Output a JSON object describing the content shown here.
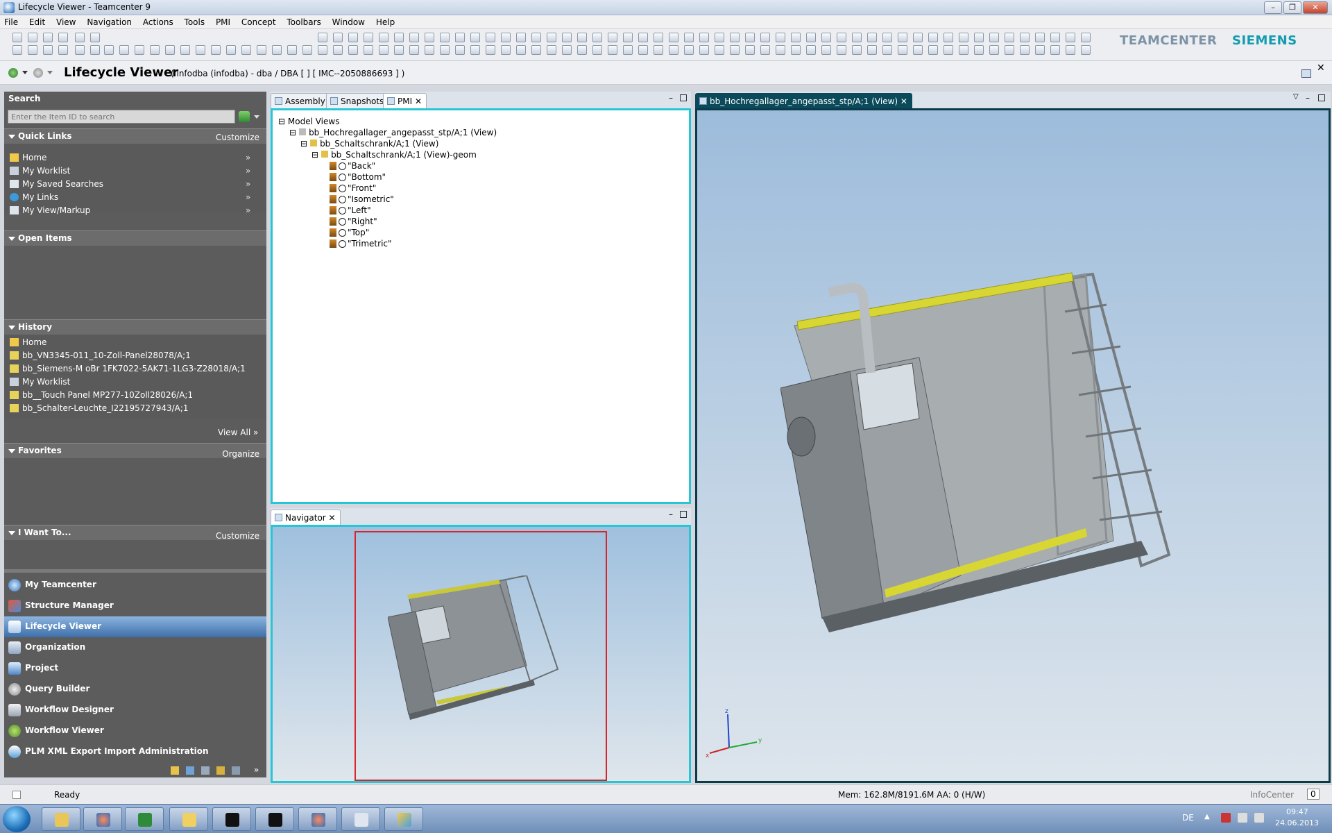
{
  "window": {
    "title": "Lifecycle Viewer - Teamcenter 9"
  },
  "menu": [
    "File",
    "Edit",
    "View",
    "Navigation",
    "Actions",
    "Tools",
    "PMI",
    "Concept",
    "Toolbars",
    "Window",
    "Help"
  ],
  "brand": {
    "teamcenter": "TEAMCENTER",
    "siemens": "SIEMENS"
  },
  "app": {
    "title": "Lifecycle Viewer",
    "context": "( infodba (infodba) - dba / DBA  [  ]  [ IMC--2050886693 ] )"
  },
  "search": {
    "header": "Search",
    "placeholder": "Enter the Item ID to search"
  },
  "quick_links": {
    "header": "Quick Links",
    "action": "Customize",
    "items": [
      "Home",
      "My Worklist",
      "My Saved Searches",
      "My Links",
      "My View/Markup"
    ]
  },
  "open_items": {
    "header": "Open Items"
  },
  "history": {
    "header": "History",
    "items": [
      "Home",
      "bb_VN3345-011_10-Zoll-Panel28078/A;1",
      "bb_Siemens-M oBr 1FK7022-5AK71-1LG3-Z28018/A;1",
      "My Worklist",
      "bb__Touch Panel MP277-10Zoll28026/A;1",
      "bb_Schalter-Leuchte_I22195727943/A;1"
    ],
    "view_all": "View All"
  },
  "favorites": {
    "header": "Favorites",
    "action": "Organize"
  },
  "iwant": {
    "header": "I Want To...",
    "action": "Customize"
  },
  "nav_apps": [
    "My Teamcenter",
    "Structure Manager",
    "Lifecycle Viewer",
    "Organization",
    "Project",
    "Query Builder",
    "Workflow Designer",
    "Workflow Viewer",
    "PLM XML Export Import Administration"
  ],
  "tabs": {
    "assembly": "Assembly",
    "snapshots": "Snapshots",
    "pmi": "PMI",
    "navigator": "Navigator",
    "viewer": "bb_Hochregallager_angepasst_stp/A;1 (View)"
  },
  "tree": {
    "root": "Model Views",
    "n1": "bb_Hochregallager_angepasst_stp/A;1 (View)",
    "n2": "bb_Schaltschrank/A;1 (View)",
    "n3": "bb_Schaltschrank/A;1 (View)-geom",
    "views": [
      "\"Back\"",
      "\"Bottom\"",
      "\"Front\"",
      "\"Isometric\"",
      "\"Left\"",
      "\"Right\"",
      "\"Top\"",
      "\"Trimetric\""
    ]
  },
  "axes": {
    "x": "x",
    "y": "y",
    "z": "z"
  },
  "status": {
    "text": "Ready",
    "mem": "Mem: 162.8M/8191.6M  AA: 0 (H/W)",
    "infocenter": "InfoCenter",
    "count": "0"
  },
  "tray": {
    "lang": "DE",
    "time": "09:47",
    "date": "24.06.2013"
  }
}
